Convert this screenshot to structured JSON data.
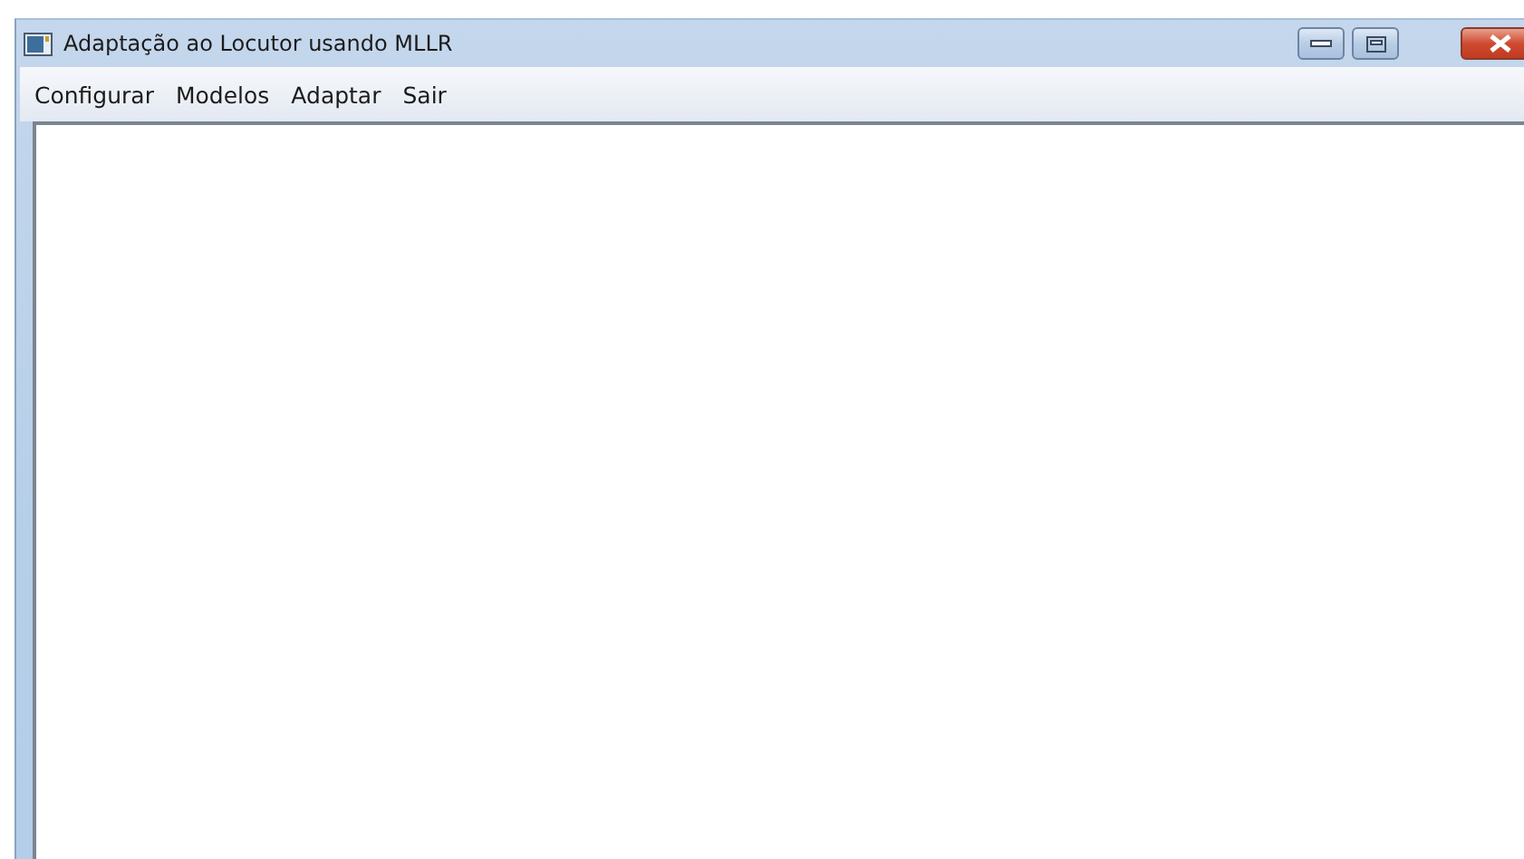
{
  "window": {
    "title": "Adaptação ao Locutor usando MLLR"
  },
  "menu": [
    {
      "label": "Configurar"
    },
    {
      "label": "Modelos"
    },
    {
      "label": "Adaptar"
    },
    {
      "label": "Sair"
    }
  ]
}
